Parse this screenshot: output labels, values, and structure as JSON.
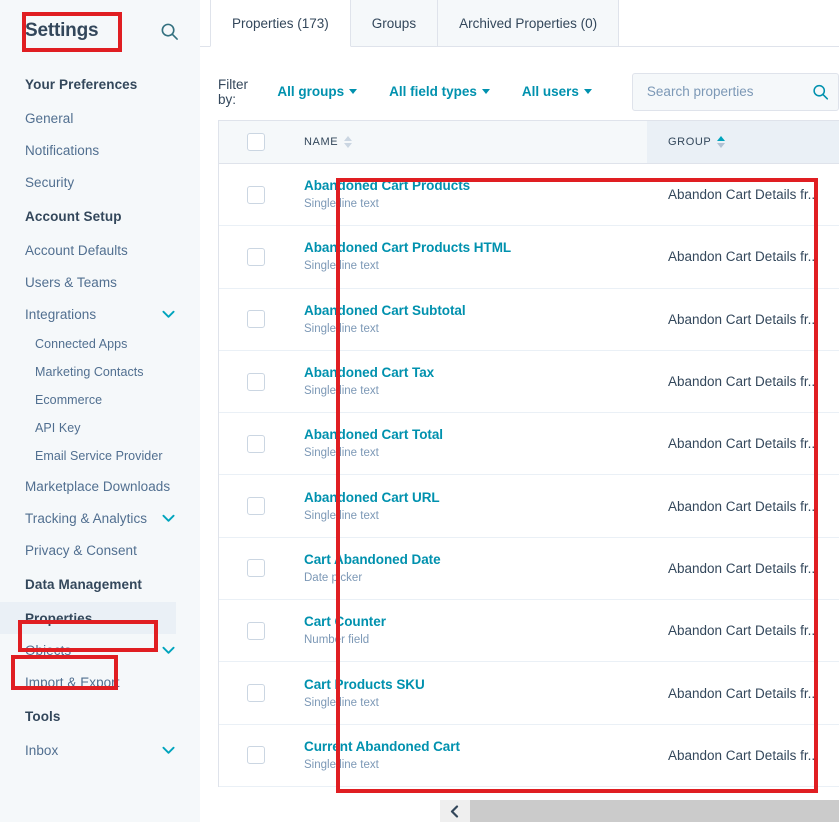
{
  "sidebar": {
    "title": "Settings",
    "search_icon": "search-icon",
    "groups": [
      {
        "header": "Your Preferences",
        "items": [
          {
            "label": "General",
            "sub": false,
            "chevron": false,
            "selected": false,
            "bold": false
          },
          {
            "label": "Notifications",
            "sub": false,
            "chevron": false,
            "selected": false,
            "bold": false
          },
          {
            "label": "Security",
            "sub": false,
            "chevron": false,
            "selected": false,
            "bold": false
          }
        ]
      },
      {
        "header": "Account Setup",
        "items": [
          {
            "label": "Account Defaults",
            "sub": false,
            "chevron": false,
            "selected": false,
            "bold": false
          },
          {
            "label": "Users & Teams",
            "sub": false,
            "chevron": false,
            "selected": false,
            "bold": false
          },
          {
            "label": "Integrations",
            "sub": false,
            "chevron": true,
            "selected": false,
            "bold": false
          },
          {
            "label": "Connected Apps",
            "sub": true,
            "chevron": false,
            "selected": false,
            "bold": false
          },
          {
            "label": "Marketing Contacts",
            "sub": true,
            "chevron": false,
            "selected": false,
            "bold": false
          },
          {
            "label": "Ecommerce",
            "sub": true,
            "chevron": false,
            "selected": false,
            "bold": false
          },
          {
            "label": "API Key",
            "sub": true,
            "chevron": false,
            "selected": false,
            "bold": false
          },
          {
            "label": "Email Service Provider",
            "sub": true,
            "chevron": false,
            "selected": false,
            "bold": false
          },
          {
            "label": "Marketplace Downloads",
            "sub": false,
            "chevron": false,
            "selected": false,
            "bold": false
          },
          {
            "label": "Tracking & Analytics",
            "sub": false,
            "chevron": true,
            "selected": false,
            "bold": false
          },
          {
            "label": "Privacy & Consent",
            "sub": false,
            "chevron": false,
            "selected": false,
            "bold": false
          }
        ]
      },
      {
        "header": "Data Management",
        "items": [
          {
            "label": "Properties",
            "sub": false,
            "chevron": false,
            "selected": true,
            "bold": true
          },
          {
            "label": "Objects",
            "sub": false,
            "chevron": true,
            "selected": false,
            "bold": false
          },
          {
            "label": "Import & Export",
            "sub": false,
            "chevron": false,
            "selected": false,
            "bold": false
          }
        ]
      },
      {
        "header": "Tools",
        "items": [
          {
            "label": "Inbox",
            "sub": false,
            "chevron": true,
            "selected": false,
            "bold": false
          }
        ]
      }
    ]
  },
  "tabs": [
    {
      "label": "Properties (173)",
      "active": true
    },
    {
      "label": "Groups",
      "active": false
    },
    {
      "label": "Archived Properties (0)",
      "active": false
    }
  ],
  "filterbar": {
    "label": "Filter by:",
    "filters": [
      {
        "label": "All groups"
      },
      {
        "label": "All field types"
      },
      {
        "label": "All users"
      }
    ]
  },
  "search": {
    "placeholder": "Search properties",
    "value": "",
    "icon": "search-icon"
  },
  "table": {
    "columns": [
      {
        "key": "check",
        "label": ""
      },
      {
        "key": "name",
        "label": "NAME",
        "sort": "none"
      },
      {
        "key": "group",
        "label": "GROUP",
        "sort": "asc"
      }
    ],
    "rows": [
      {
        "name": "Abandoned Cart Products",
        "type": "Single line text",
        "group": "Abandon Cart Details fr..."
      },
      {
        "name": "Abandoned Cart Products HTML",
        "type": "Single line text",
        "group": "Abandon Cart Details fr..."
      },
      {
        "name": "Abandoned Cart Subtotal",
        "type": "Single line text",
        "group": "Abandon Cart Details fr..."
      },
      {
        "name": "Abandoned Cart Tax",
        "type": "Single line text",
        "group": "Abandon Cart Details fr..."
      },
      {
        "name": "Abandoned Cart Total",
        "type": "Single line text",
        "group": "Abandon Cart Details fr..."
      },
      {
        "name": "Abandoned Cart URL",
        "type": "Single line text",
        "group": "Abandon Cart Details fr..."
      },
      {
        "name": "Cart Abandoned Date",
        "type": "Date picker",
        "group": "Abandon Cart Details fr..."
      },
      {
        "name": "Cart Counter",
        "type": "Number field",
        "group": "Abandon Cart Details fr..."
      },
      {
        "name": "Cart Products SKU",
        "type": "Single line text",
        "group": "Abandon Cart Details fr..."
      },
      {
        "name": "Current Abandoned Cart",
        "type": "Single line text",
        "group": "Abandon Cart Details fr..."
      }
    ]
  },
  "scrollbar": {
    "left_arrow_icon": "chevron-left-icon"
  },
  "colors": {
    "accent_teal": "#0091ae",
    "dark_blue": "#33475b",
    "muted_blue": "#516f90",
    "sidebar_bg": "#f5f8fa",
    "annotation_red": "#e01e22",
    "border": "#dfe3eb"
  },
  "annotations": [
    {
      "name": "settings-title-highlight"
    },
    {
      "name": "data-management-highlight"
    },
    {
      "name": "properties-nav-highlight"
    },
    {
      "name": "properties-table-highlight"
    }
  ]
}
